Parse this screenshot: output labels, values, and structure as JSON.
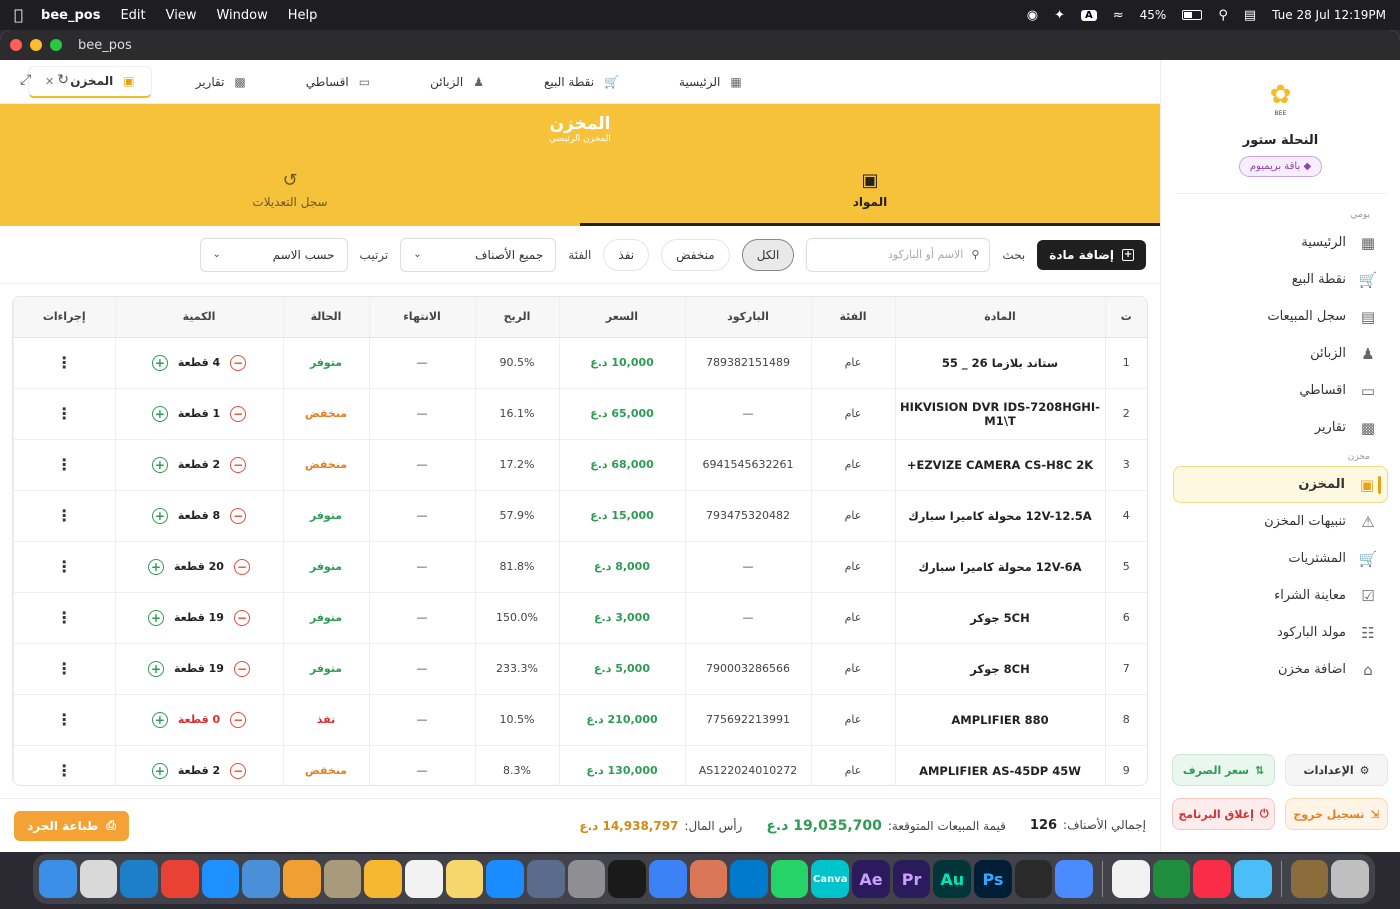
{
  "menubar": {
    "app": "bee_pos",
    "menus": [
      "Edit",
      "View",
      "Window",
      "Help"
    ],
    "input_source": "A",
    "battery": "45%",
    "battery_level": 0.45,
    "datetime": "Tue 28 Jul  12:19PM"
  },
  "window": {
    "title": "bee_pos"
  },
  "topnav": {
    "tabs": [
      {
        "label": "الرئيسية",
        "icon": "grid-icon"
      },
      {
        "label": "نقطة البيع",
        "icon": "cart-icon"
      },
      {
        "label": "الزبائن",
        "icon": "users-icon"
      },
      {
        "label": "اقساطي",
        "icon": "card-icon"
      },
      {
        "label": "تقارير",
        "icon": "chart-icon"
      },
      {
        "label": "المخزن",
        "icon": "archive-icon",
        "active": true
      }
    ]
  },
  "hero": {
    "title": "المخزن",
    "subtitle": "المخزن الرئيسي",
    "tab_items": "المواد",
    "tab_history": "سجل التعديلات"
  },
  "filters": {
    "add_label": "إضافة مادة",
    "search_label": "بحث",
    "search_placeholder": "الاسم أو الباركود",
    "chips": [
      "الكل",
      "منخفض",
      "نفذ"
    ],
    "category_label": "الفئة",
    "category_value": "جميع الأصناف",
    "sort_label": "ترتيب",
    "sort_value": "حسب الاسم"
  },
  "table": {
    "headers": [
      "ت",
      "المادة",
      "الفئة",
      "الباركود",
      "السعر",
      "الربح",
      "الانتهاء",
      "الحالة",
      "الكمية",
      "إجراءات"
    ],
    "rows": [
      {
        "n": "1",
        "name": "ستاند  بلازما 26 _ 55",
        "cat": "عام",
        "barcode": "789382151489",
        "price": "10,000 د.ع",
        "profit": "90.5%",
        "exp": "—",
        "status": "متوفر",
        "st": "green",
        "qty": "4 قطعة"
      },
      {
        "n": "2",
        "name": "HIKVISION DVR IDS-7208HGHI-M1\\T",
        "cat": "عام",
        "barcode": "—",
        "price": "65,000 د.ع",
        "profit": "16.1%",
        "exp": "—",
        "status": "منخفض",
        "st": "orange",
        "qty": "1 قطعة"
      },
      {
        "n": "3",
        "name": "EZVIZE CAMERA CS-H8C 2K+",
        "cat": "عام",
        "barcode": "6941545632261",
        "price": "68,000 د.ع",
        "profit": "17.2%",
        "exp": "—",
        "status": "منخفض",
        "st": "orange",
        "qty": "2 قطعة"
      },
      {
        "n": "4",
        "name": "12V-12.5A محولة كاميرا سبارك",
        "cat": "عام",
        "barcode": "793475320482",
        "price": "15,000 د.ع",
        "profit": "57.9%",
        "exp": "—",
        "status": "متوفر",
        "st": "green",
        "qty": "8 قطعة"
      },
      {
        "n": "5",
        "name": "12V-6A محولة كاميرا سبارك",
        "cat": "عام",
        "barcode": "—",
        "price": "8,000 د.ع",
        "profit": "81.8%",
        "exp": "—",
        "status": "متوفر",
        "st": "green",
        "qty": "20 قطعة"
      },
      {
        "n": "6",
        "name": "5CH جوكر",
        "cat": "عام",
        "barcode": "—",
        "price": "3,000 د.ع",
        "profit": "150.0%",
        "exp": "—",
        "status": "متوفر",
        "st": "green",
        "qty": "19 قطعة"
      },
      {
        "n": "7",
        "name": "8CH جوكر",
        "cat": "عام",
        "barcode": "790003286566",
        "price": "5,000 د.ع",
        "profit": "233.3%",
        "exp": "—",
        "status": "متوفر",
        "st": "green",
        "qty": "19 قطعة"
      },
      {
        "n": "8",
        "name": "AMPLIFIER 880",
        "cat": "عام",
        "barcode": "775692213991",
        "price": "210,000 د.ع",
        "profit": "10.5%",
        "exp": "—",
        "status": "نفذ",
        "st": "red",
        "qty": "0 قطعة"
      },
      {
        "n": "9",
        "name": "AMPLIFIER AS-45DP 45W",
        "cat": "عام",
        "barcode": "AS122024010272",
        "price": "130,000 د.ع",
        "profit": "8.3%",
        "exp": "—",
        "status": "منخفض",
        "st": "orange",
        "qty": "2 قطعة"
      }
    ]
  },
  "footer": {
    "total_items_label": "إجمالي الأصناف:",
    "total_items": "126",
    "expected_sales_label": "قيمة المبيعات المتوقعة:",
    "expected_sales": "19,035,700 د.ع",
    "capital_label": "رأس المال:",
    "capital": "14,938,797 د.ع",
    "print_label": "طباعة الجرد"
  },
  "sidebar": {
    "logo_text": "BEE",
    "store_name": "النحلة ستور",
    "plan": "باقة بريميوم",
    "section_daily": "يومي",
    "daily_items": [
      {
        "label": "الرئيسية",
        "icon": "grid-icon"
      },
      {
        "label": "نقطة البيع",
        "icon": "cart-icon"
      },
      {
        "label": "سجل المبيعات",
        "icon": "receipt-icon"
      },
      {
        "label": "الزبائن",
        "icon": "users-icon"
      },
      {
        "label": "اقساطي",
        "icon": "card-icon"
      },
      {
        "label": "تقارير",
        "icon": "chart-icon"
      }
    ],
    "section_store": "مخزن",
    "store_items": [
      {
        "label": "المخزن",
        "icon": "archive-icon",
        "active": true
      },
      {
        "label": "تنبيهات المخزن",
        "icon": "warning-icon"
      },
      {
        "label": "المشتريات",
        "icon": "cart-plus-icon"
      },
      {
        "label": "معاينة الشراء",
        "icon": "checklist-icon"
      },
      {
        "label": "مولد الباركود",
        "icon": "qr-icon"
      },
      {
        "label": "اضافة مخزن",
        "icon": "warehouse-icon"
      }
    ],
    "settings": "الإعدادات",
    "exchange_rate": "سعر الصرف",
    "logout": "تسجيل خروج",
    "close_app": "إغلاق البرنامج"
  },
  "dock": {
    "apps": [
      "Finder",
      "Launchpad",
      "Edge",
      "Chrome",
      "Safari",
      "Mail",
      "Photos",
      "Contacts",
      "Pages",
      "Reminders",
      "Notes",
      "App Store",
      "Simulator",
      "Settings",
      "ChatGPT",
      "Gemini",
      "Claude",
      "VS Code",
      "WhatsApp",
      "Canva",
      "Ae",
      "Pr",
      "Au",
      "Ps",
      "DaVinci",
      "Proxyman",
      "Text",
      "Numbers",
      "Music",
      "Flutter",
      "Archive",
      "Trash"
    ],
    "labels": {
      "canva": "Canva",
      "ae": "Ae",
      "pr": "Pr",
      "au": "Au",
      "ps": "Ps"
    }
  }
}
